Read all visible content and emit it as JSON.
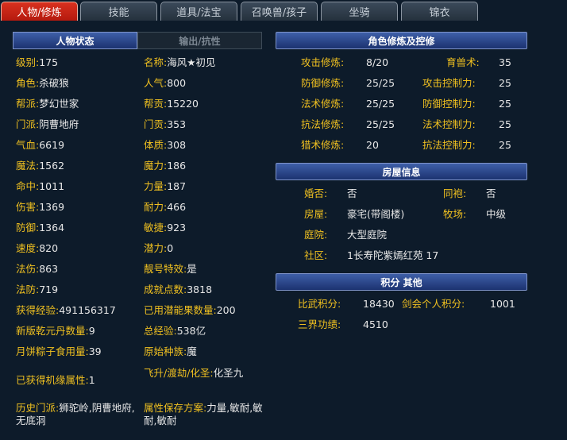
{
  "tabs": [
    "人物/修炼",
    "技能",
    "道具/法宝",
    "召唤兽/孩子",
    "坐骑",
    "锦衣"
  ],
  "status_tabs": [
    "人物状态",
    "输出/抗性"
  ],
  "left_fields": [
    {
      "label": "级别:",
      "value": "175"
    },
    {
      "label": "名称:",
      "value": "海风★初见"
    },
    {
      "label": "角色:",
      "value": "杀破狼"
    },
    {
      "label": "人气:",
      "value": "800"
    },
    {
      "label": "帮派:",
      "value": "梦幻世家"
    },
    {
      "label": "帮贡:",
      "value": "15220"
    },
    {
      "label": "门派:",
      "value": "阴曹地府"
    },
    {
      "label": "门贡:",
      "value": "353"
    },
    {
      "label": "气血:",
      "value": "6619"
    },
    {
      "label": "体质:",
      "value": "308"
    },
    {
      "label": "魔法:",
      "value": "1562"
    },
    {
      "label": "魔力:",
      "value": "186"
    },
    {
      "label": "命中:",
      "value": "1011"
    },
    {
      "label": "力量:",
      "value": "187"
    },
    {
      "label": "伤害:",
      "value": "1369"
    },
    {
      "label": "耐力:",
      "value": "466"
    },
    {
      "label": "防御:",
      "value": "1364"
    },
    {
      "label": "敏捷:",
      "value": "923"
    },
    {
      "label": "速度:",
      "value": "820"
    },
    {
      "label": "潜力:",
      "value": "0"
    },
    {
      "label": "法伤:",
      "value": "863"
    },
    {
      "label": "靓号特效:",
      "value": "是"
    },
    {
      "label": "法防:",
      "value": "719"
    },
    {
      "label": "成就点数:",
      "value": "3818"
    },
    {
      "label": "获得经验:",
      "value": "491156317"
    },
    {
      "label": "已用潜能果数量:",
      "value": "200"
    },
    {
      "label": "新版乾元丹数量:",
      "value": "9"
    },
    {
      "label": "总经验:",
      "value": "538亿"
    },
    {
      "label": "月饼粽子食用量:",
      "value": "39"
    },
    {
      "label": "原始种族:",
      "value": "魔"
    },
    {
      "label": "已获得机缘属性:",
      "value": "1"
    },
    {
      "label": "飞升/渡劫/化圣:",
      "value": "化圣九"
    },
    {
      "label": "历史门派:",
      "value": "狮驼岭,阴曹地府,无底洞"
    },
    {
      "label": "属性保存方案:",
      "value": "力量,敏耐,敏耐,敏耐"
    }
  ],
  "cultivation_title": "角色修炼及控修",
  "cultivation": [
    {
      "label": "攻击修炼:",
      "value": "8/20"
    },
    {
      "label": "育兽术:",
      "value": "35"
    },
    {
      "label": "防御修炼:",
      "value": "25/25"
    },
    {
      "label": "攻击控制力:",
      "value": "25"
    },
    {
      "label": "法术修炼:",
      "value": "25/25"
    },
    {
      "label": "防御控制力:",
      "value": "25"
    },
    {
      "label": "抗法修炼:",
      "value": "25/25"
    },
    {
      "label": "法术控制力:",
      "value": "25"
    },
    {
      "label": "猎术修炼:",
      "value": "20"
    },
    {
      "label": "抗法控制力:",
      "value": "25"
    }
  ],
  "house_title": "房屋信息",
  "house": [
    {
      "label": "婚否:",
      "value": "否"
    },
    {
      "label": "同袍:",
      "value": "否"
    },
    {
      "label": "房屋:",
      "value": "豪宅(带阁楼)"
    },
    {
      "label": "牧场:",
      "value": "中级"
    },
    {
      "label": "庭院:",
      "value": "大型庭院"
    },
    {
      "label": "社区:",
      "value": "1长寿陀紫嫣红苑  17"
    }
  ],
  "score_title": "积分 其他",
  "score": [
    {
      "label": "比武积分:",
      "value": "18430"
    },
    {
      "label": "剑会个人积分:",
      "value": "1001"
    },
    {
      "label": "三界功绩:",
      "value": "4510"
    }
  ],
  "colors": {
    "label": "#f0c020",
    "value": "#e8e8e8",
    "active_tab": "#c8251a",
    "header": "#2a4590",
    "background": "#0d1b2a"
  }
}
